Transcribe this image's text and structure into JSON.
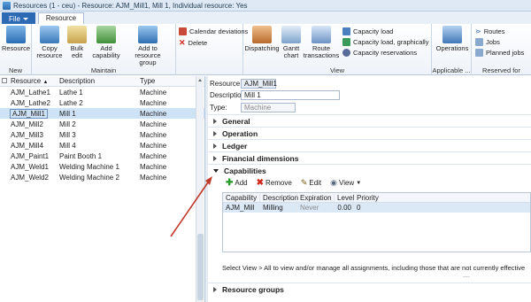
{
  "window": {
    "title": "Resources (1 - ceu) - Resource: AJM_Mill1, Mill 1, Individual resource: Yes"
  },
  "tabs": {
    "file": "File",
    "resource": "Resource"
  },
  "ribbon": {
    "groups": {
      "new": "New",
      "maintain": "Maintain",
      "view": "View",
      "applicable": "Applicable ...",
      "reserved": "Reserved for"
    },
    "buttons": {
      "resource": "Resource",
      "copy_resource_1": "Copy",
      "copy_resource_2": "resource",
      "bulk_edit_1": "Bulk",
      "bulk_edit_2": "edit",
      "add_capability_1": "Add",
      "add_capability_2": "capability",
      "add_to_group_1": "Add to resource",
      "add_to_group_2": "group",
      "calendar_deviations": "Calendar deviations",
      "delete": "Delete",
      "dispatching": "Dispatching",
      "gantt_1": "Gantt",
      "gantt_2": "chart",
      "route_tx_1": "Route",
      "route_tx_2": "transactions",
      "capacity_load": "Capacity load",
      "capacity_load_graphically": "Capacity load, graphically",
      "capacity_reservations": "Capacity reservations",
      "operations": "Operations",
      "routes": "Routes",
      "jobs": "Jobs",
      "planned_jobs": "Planned jobs"
    }
  },
  "list": {
    "headers": {
      "resource": "Resource",
      "description": "Description",
      "type": "Type"
    },
    "rows": [
      {
        "resource": "AJM_Lathe1",
        "description": "Lathe 1",
        "type": "Machine"
      },
      {
        "resource": "AJM_Lathe2",
        "description": "Lathe 2",
        "type": "Machine"
      },
      {
        "resource": "AJM_Mill1",
        "description": "Mill 1",
        "type": "Machine"
      },
      {
        "resource": "AJM_Mill2",
        "description": "Mill 2",
        "type": "Machine"
      },
      {
        "resource": "AJM_Mill3",
        "description": "Mill 3",
        "type": "Machine"
      },
      {
        "resource": "AJM_Mill4",
        "description": "Mill 4",
        "type": "Machine"
      },
      {
        "resource": "AJM_Paint1",
        "description": "Paint Booth 1",
        "type": "Machine"
      },
      {
        "resource": "AJM_Weld1",
        "description": "Welding Machine 1",
        "type": "Machine"
      },
      {
        "resource": "AJM_Weld2",
        "description": "Welding Machine 2",
        "type": "Machine"
      }
    ]
  },
  "detail": {
    "resource_label": "Resource:",
    "resource_value": "AJM_Mill1",
    "description_label": "Description:",
    "description_value": "Mill 1",
    "type_label": "Type:",
    "type_value": "Machine",
    "fasttabs": {
      "general": "General",
      "operation": "Operation",
      "ledger": "Ledger",
      "financial": "Financial dimensions",
      "capabilities": "Capabilities",
      "resource_groups": "Resource groups"
    },
    "toolbar": {
      "add": "Add",
      "remove": "Remove",
      "edit": "Edit",
      "view": "View"
    },
    "grid_headers": {
      "capability": "Capability",
      "description": "Description",
      "expiration": "Expiration",
      "level": "Level",
      "priority": "Priority"
    },
    "grid_row": {
      "capability": "AJM_Mill",
      "description": "Milling",
      "expiration": "Never",
      "level": "0.00",
      "priority": "0"
    },
    "hint": "Select View > All to view and/or manage all assignments, including those that are not currently effective",
    "dots": "...."
  }
}
